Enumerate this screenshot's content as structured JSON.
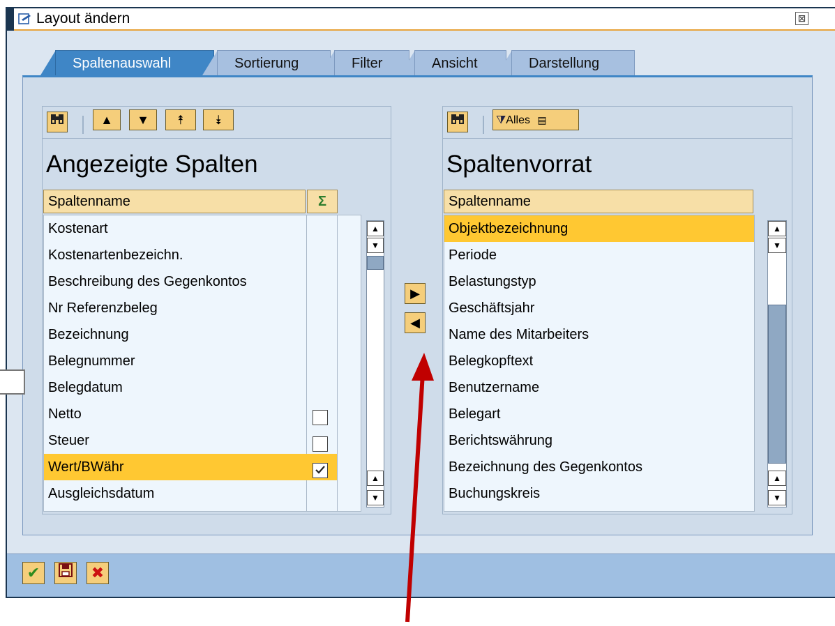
{
  "window": {
    "title": "Layout ändern",
    "close_symbol": "⊠"
  },
  "tabs": [
    {
      "label": "Spaltenauswahl",
      "active": true
    },
    {
      "label": "Sortierung",
      "active": false
    },
    {
      "label": "Filter",
      "active": false
    },
    {
      "label": "Ansicht",
      "active": false
    },
    {
      "label": "Darstellung",
      "active": false
    }
  ],
  "left_panel": {
    "title": "Angezeigte Spalten",
    "column_header": "Spaltenname",
    "sum_header_symbol": "Σ",
    "rows": [
      {
        "label": "Kostenart"
      },
      {
        "label": "Kostenartenbezeichn."
      },
      {
        "label": "Beschreibung des Gegenkontos"
      },
      {
        "label": "Nr Referenzbeleg"
      },
      {
        "label": "Bezeichnung"
      },
      {
        "label": "Belegnummer"
      },
      {
        "label": "Belegdatum"
      },
      {
        "label": "Netto"
      },
      {
        "label": "Steuer"
      },
      {
        "label": "Wert/BWähr"
      },
      {
        "label": "Ausgleichsdatum"
      }
    ],
    "checkboxes": {
      "netto": false,
      "steuer": false,
      "wert_bwaehr": true
    },
    "selected_row": "Wert/BWähr"
  },
  "right_panel": {
    "title": "Spaltenvorrat",
    "column_header": "Spaltenname",
    "filter_label": "Alles",
    "rows": [
      {
        "label": "Objektbezeichnung"
      },
      {
        "label": "Periode"
      },
      {
        "label": "Belastungstyp"
      },
      {
        "label": "Geschäftsjahr"
      },
      {
        "label": "Name des Mitarbeiters"
      },
      {
        "label": "Belegkopftext"
      },
      {
        "label": "Benutzername"
      },
      {
        "label": "Belegart"
      },
      {
        "label": "Berichtswährung"
      },
      {
        "label": "Bezeichnung des Gegenkontos"
      },
      {
        "label": "Buchungskreis"
      }
    ],
    "selected_row": "Objektbezeichnung"
  },
  "icons": {
    "find": "binoculars-icon",
    "up": "▲",
    "down": "▼",
    "top": "⯭",
    "bottom": "⯯",
    "move_right": "▶",
    "move_left": "◀",
    "confirm": "✔",
    "save": "💾",
    "cancel": "✖"
  },
  "colors": {
    "selection": "#ffc832",
    "tab_active": "#3f86c6",
    "annotation_arrow": "#c00000"
  }
}
